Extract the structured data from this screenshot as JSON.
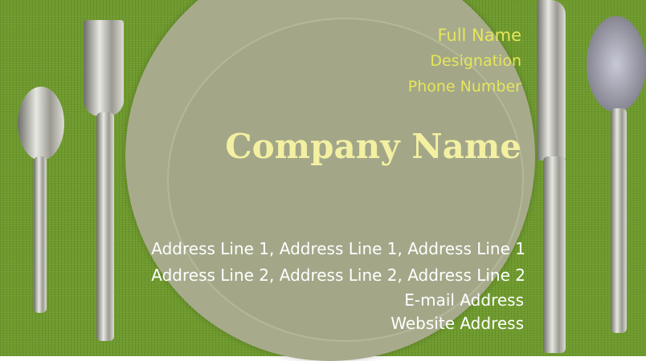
{
  "card": {
    "full_name": "Full Name",
    "designation": "Designation",
    "phone": "Phone Number",
    "company": "Company Name",
    "address_1": "Address Line 1, Address Line 1, Address Line 1",
    "address_2": "Address Line 2, Address Line 2, Address Line 2",
    "email": "E-mail Address",
    "website": "Website Address"
  }
}
